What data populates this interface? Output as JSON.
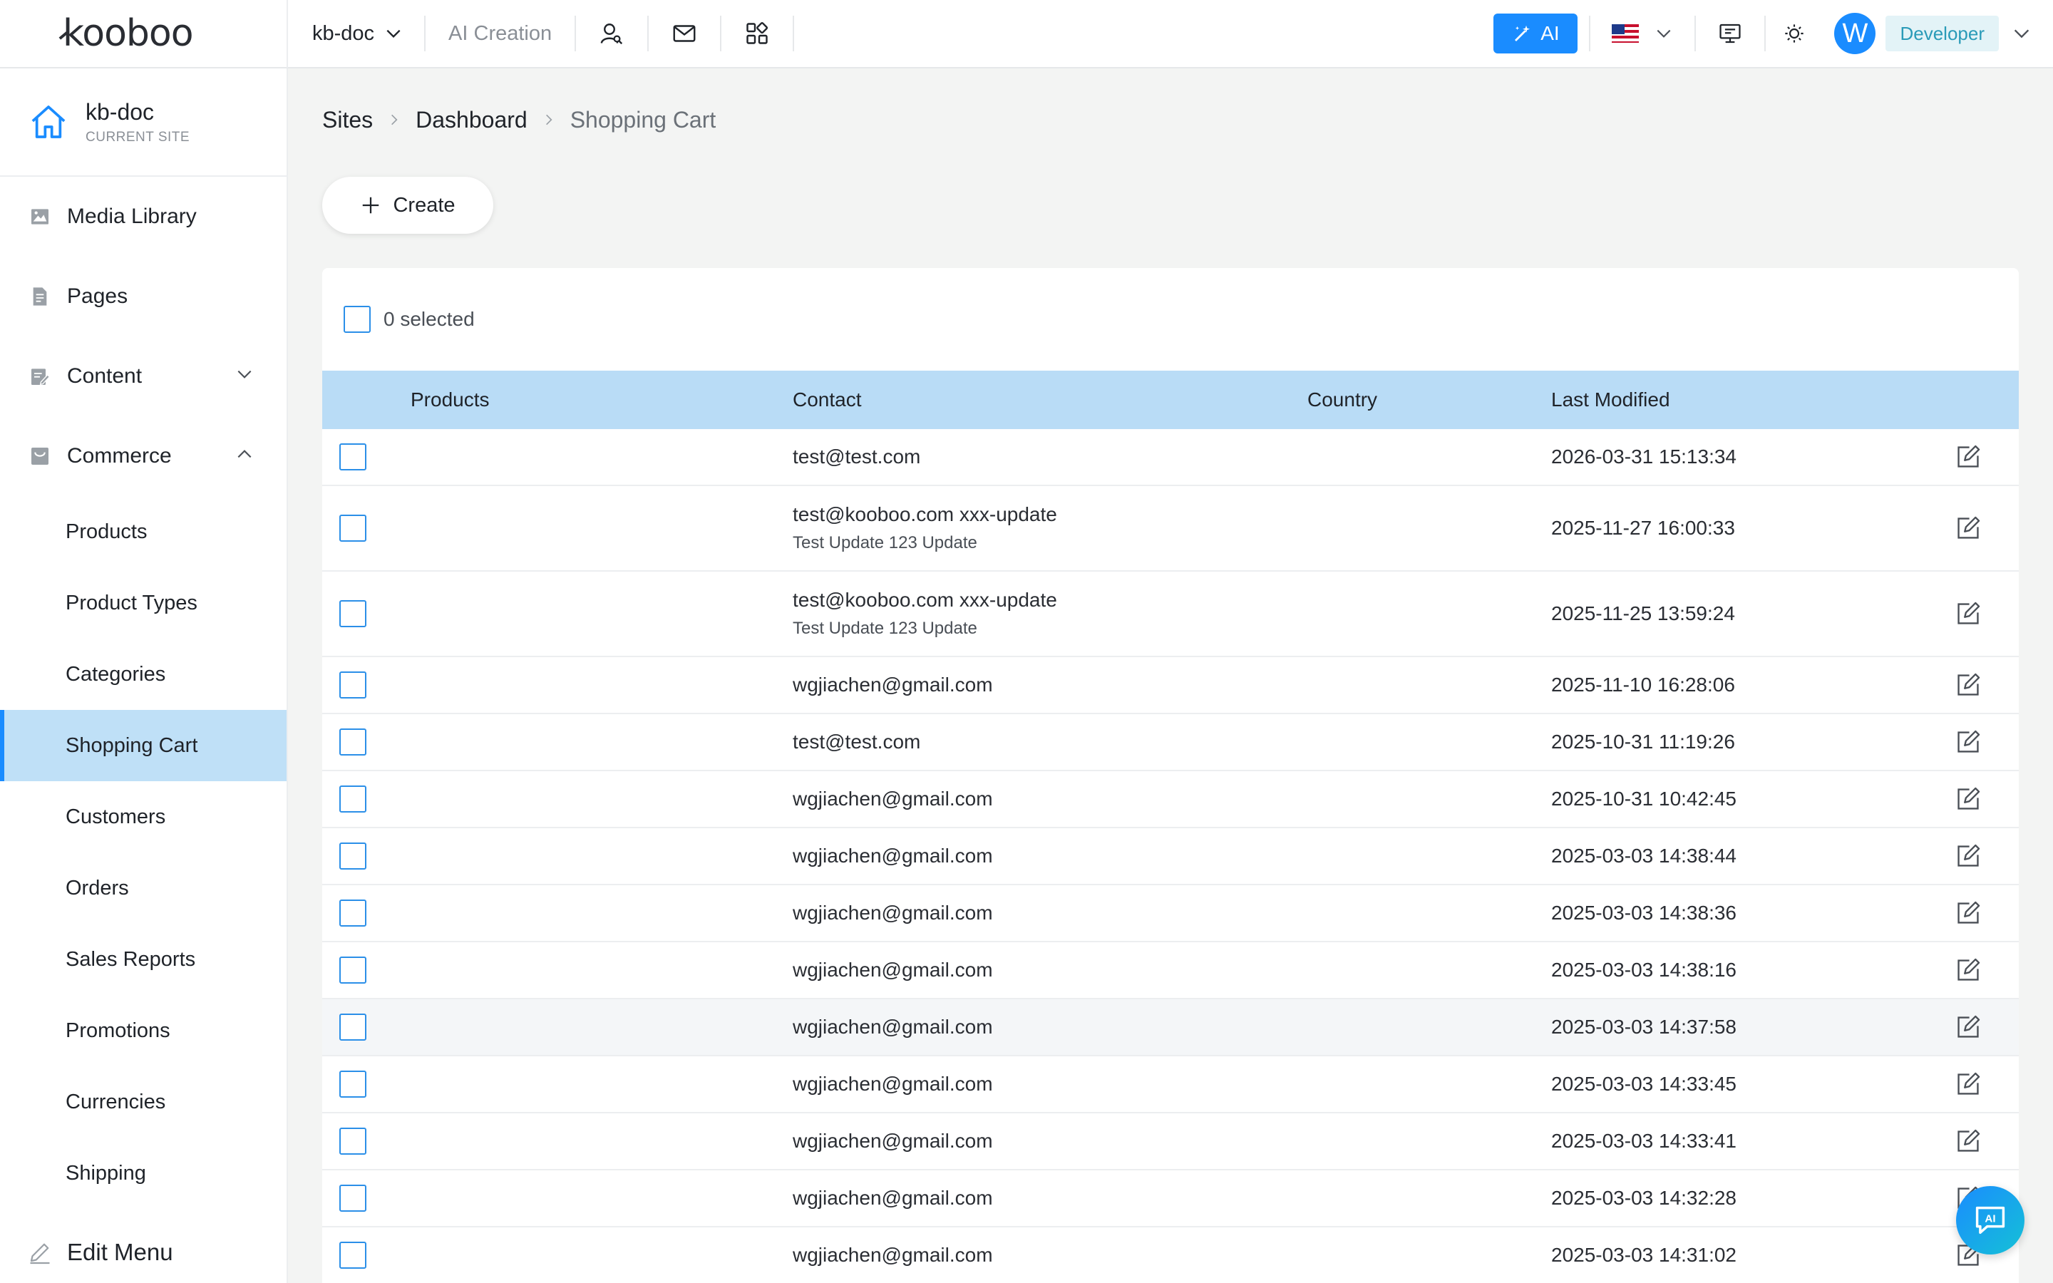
{
  "header": {
    "logo": "kooboo",
    "site_select": "kb-doc",
    "ai_creation": "AI Creation",
    "ai_button": "AI",
    "avatar_letter": "W",
    "role": "Developer",
    "icons": [
      "user-search-icon",
      "mail-icon",
      "apps-icon",
      "ai-magic-icon",
      "us-flag-icon",
      "monitor-icon",
      "sun-icon"
    ]
  },
  "sidebar": {
    "current_site": {
      "name": "kb-doc",
      "label": "CURRENT SITE"
    },
    "items": [
      {
        "label": "Media Library",
        "icon": "image-icon"
      },
      {
        "label": "Pages",
        "icon": "file-icon"
      },
      {
        "label": "Content",
        "icon": "edit-doc-icon",
        "expandable": true,
        "expanded": false
      },
      {
        "label": "Commerce",
        "icon": "shop-icon",
        "expandable": true,
        "expanded": true
      }
    ],
    "commerce_children": [
      {
        "label": "Products"
      },
      {
        "label": "Product Types"
      },
      {
        "label": "Categories"
      },
      {
        "label": "Shopping Cart",
        "active": true
      },
      {
        "label": "Customers"
      },
      {
        "label": "Orders"
      },
      {
        "label": "Sales Reports"
      },
      {
        "label": "Promotions"
      },
      {
        "label": "Currencies"
      },
      {
        "label": "Shipping"
      }
    ],
    "edit_menu": "Edit Menu"
  },
  "breadcrumb": [
    {
      "label": "Sites"
    },
    {
      "label": "Dashboard"
    },
    {
      "label": "Shopping Cart",
      "current": true
    }
  ],
  "toolbar": {
    "create_label": "Create"
  },
  "table": {
    "selected_text": "0 selected",
    "columns": [
      "Products",
      "Contact",
      "Country",
      "Last Modified"
    ],
    "rows": [
      {
        "products": "",
        "contact": "test@test.com",
        "contact_sub": "",
        "country": "",
        "modified": "2026-03-31 15:13:34"
      },
      {
        "products": "",
        "contact": "test@kooboo.com xxx-update",
        "contact_sub": "Test Update 123 Update",
        "country": "",
        "modified": "2025-11-27 16:00:33"
      },
      {
        "products": "",
        "contact": "test@kooboo.com xxx-update",
        "contact_sub": "Test Update 123 Update",
        "country": "",
        "modified": "2025-11-25 13:59:24"
      },
      {
        "products": "",
        "contact": "wgjiachen@gmail.com",
        "contact_sub": "",
        "country": "",
        "modified": "2025-11-10 16:28:06"
      },
      {
        "products": "",
        "contact": "test@test.com",
        "contact_sub": "",
        "country": "",
        "modified": "2025-10-31 11:19:26"
      },
      {
        "products": "",
        "contact": "wgjiachen@gmail.com",
        "contact_sub": "",
        "country": "",
        "modified": "2025-10-31 10:42:45"
      },
      {
        "products": "",
        "contact": "wgjiachen@gmail.com",
        "contact_sub": "",
        "country": "",
        "modified": "2025-03-03 14:38:44"
      },
      {
        "products": "",
        "contact": "wgjiachen@gmail.com",
        "contact_sub": "",
        "country": "",
        "modified": "2025-03-03 14:38:36"
      },
      {
        "products": "",
        "contact": "wgjiachen@gmail.com",
        "contact_sub": "",
        "country": "",
        "modified": "2025-03-03 14:38:16"
      },
      {
        "products": "",
        "contact": "wgjiachen@gmail.com",
        "contact_sub": "",
        "country": "",
        "modified": "2025-03-03 14:37:58",
        "hovered": true
      },
      {
        "products": "",
        "contact": "wgjiachen@gmail.com",
        "contact_sub": "",
        "country": "",
        "modified": "2025-03-03 14:33:45"
      },
      {
        "products": "",
        "contact": "wgjiachen@gmail.com",
        "contact_sub": "",
        "country": "",
        "modified": "2025-03-03 14:33:41"
      },
      {
        "products": "",
        "contact": "wgjiachen@gmail.com",
        "contact_sub": "",
        "country": "",
        "modified": "2025-03-03 14:32:28"
      },
      {
        "products": "",
        "contact": "wgjiachen@gmail.com",
        "contact_sub": "",
        "country": "",
        "modified": "2025-03-03 14:31:02"
      }
    ]
  },
  "colors": {
    "accent": "#1a8cff",
    "table_header": "#b9dcf6",
    "active_nav": "#bfe0f7",
    "role_badge_bg": "#e3f3f7",
    "role_badge_text": "#2a9bb8"
  }
}
